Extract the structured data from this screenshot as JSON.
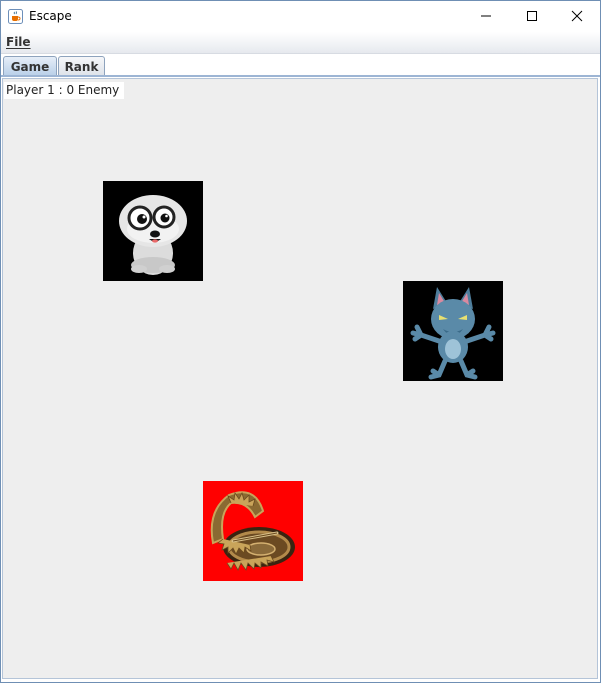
{
  "window": {
    "title": "Escape",
    "icon": "java-cup-icon"
  },
  "menubar": {
    "items": [
      {
        "label": "File"
      }
    ]
  },
  "tabs": [
    {
      "label": "Game",
      "selected": true
    },
    {
      "label": "Rank",
      "selected": false
    }
  ],
  "game": {
    "score_text": "Player 1 : 0 Enemy",
    "background_color": "#eeeeee",
    "sprites": [
      {
        "kind": "player",
        "icon": "cartoon-seal-icon",
        "background": "#000000"
      },
      {
        "kind": "enemy",
        "icon": "werewolf-icon",
        "background": "#000000"
      },
      {
        "kind": "trap",
        "icon": "bear-trap-icon",
        "background": "#ff0000"
      }
    ]
  }
}
